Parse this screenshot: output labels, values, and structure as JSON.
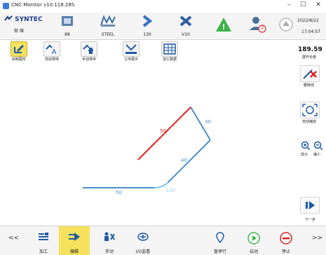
{
  "window": {
    "title": "CNC Monitor v10.118.28S",
    "minimize": "–",
    "maximize": "☐",
    "close": "✕"
  },
  "toolbar": {
    "brand": "SYNTEC",
    "brand_sub": "就 绪",
    "items": [
      {
        "label": "88"
      },
      {
        "label": "STEEL"
      },
      {
        "label": "130"
      },
      {
        "label": "V10"
      }
    ],
    "date": "2022/8/22",
    "time": "17:04:57",
    "user_badge": "2"
  },
  "functions": [
    {
      "label": "绘制图形"
    },
    {
      "label": "自动排序"
    },
    {
      "label": "手动排序"
    },
    {
      "label": "工序展示"
    },
    {
      "label": "加工数据"
    }
  ],
  "right_panel": {
    "value": "189.59",
    "value_label": "展开长度",
    "delete_label": "删除线",
    "autozoom_label": "自动缩放",
    "zoom_in_label": "放大",
    "zoom_out_label": "缩小",
    "next_label": "下一步"
  },
  "drawing": {
    "segment_labels": [
      "50",
      "135°",
      "40",
      "30",
      "50"
    ],
    "colors": {
      "segment": "#4a8fc8",
      "selected": "#e02020",
      "arc": "#7ec8f0"
    }
  },
  "bottom": {
    "prev": "<<",
    "next": ">>",
    "items": [
      {
        "label": "加工"
      },
      {
        "label": "编辑"
      },
      {
        "label": "手动"
      },
      {
        "label": "I/O监看"
      },
      {
        "label": "暂停行"
      },
      {
        "label": "启动"
      },
      {
        "label": "停止"
      }
    ]
  }
}
